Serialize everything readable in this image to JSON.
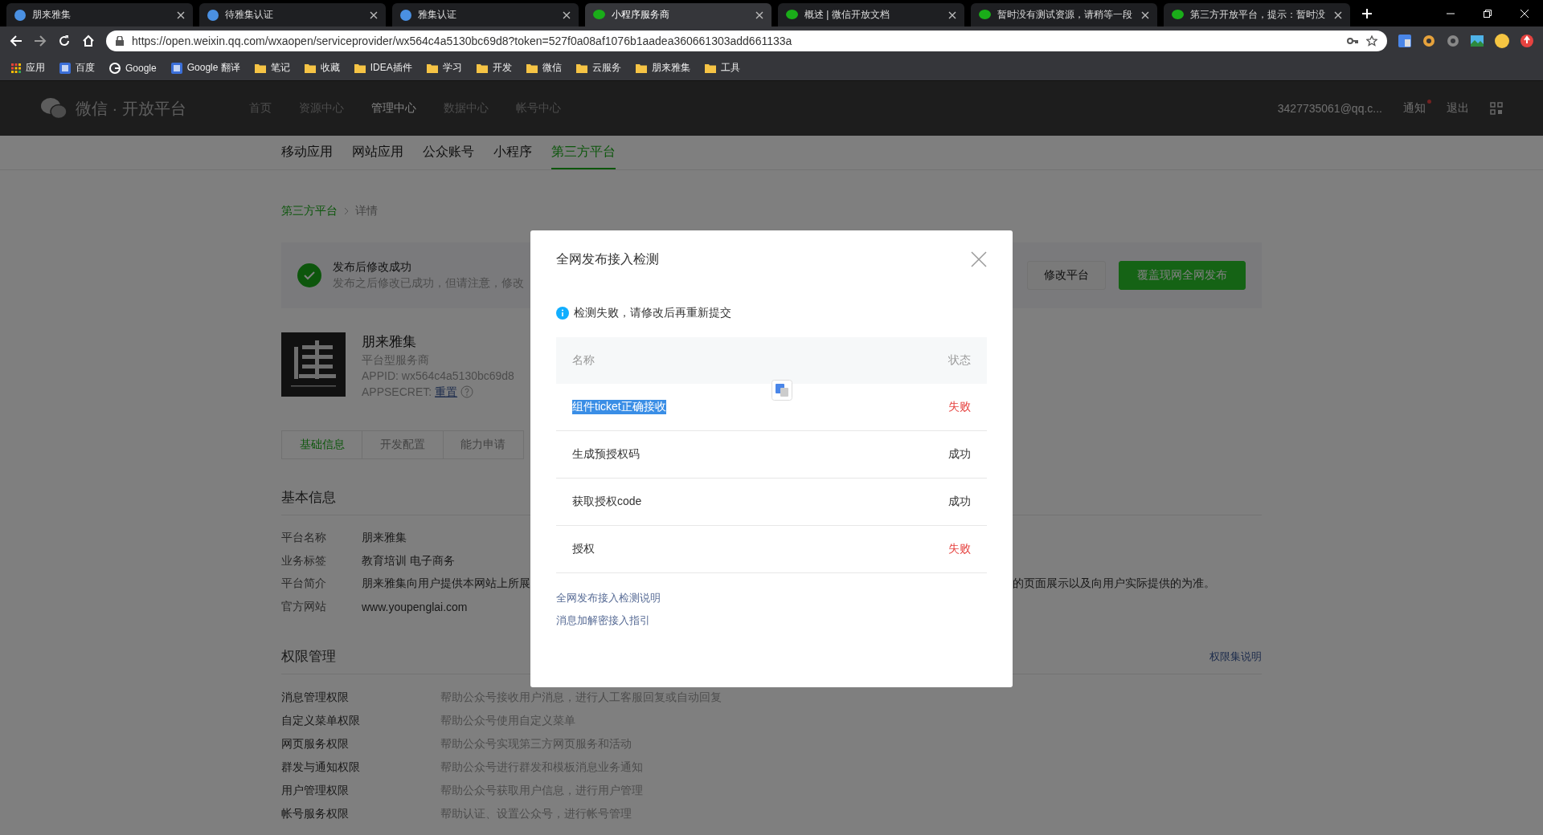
{
  "browser": {
    "tabs": [
      {
        "title": "朋来雅集",
        "selected": false,
        "kind": "site"
      },
      {
        "title": "待雅集认证",
        "selected": false,
        "kind": "site"
      },
      {
        "title": "雅集认证",
        "selected": false,
        "kind": "site"
      },
      {
        "title": "小程序服务商",
        "selected": true,
        "kind": "wechat"
      },
      {
        "title": "概述 | 微信开放文档",
        "selected": false,
        "kind": "wechat"
      },
      {
        "title": "暂时没有测试资源，请稍等一段",
        "selected": false,
        "kind": "wechat"
      },
      {
        "title": "第三方开放平台，提示：暂时没",
        "selected": false,
        "kind": "wechat"
      }
    ],
    "url": "https://open.weixin.qq.com/wxaopen/serviceprovider/wx564c4a5130bc69d8?token=527f0a08af1076b1aadea360661303add661133a",
    "bookmarks": [
      {
        "label": "应用",
        "kind": "apps"
      },
      {
        "label": "百度",
        "kind": "site"
      },
      {
        "label": "Google",
        "kind": "google"
      },
      {
        "label": "Google 翻译",
        "kind": "site"
      },
      {
        "label": "笔记",
        "kind": "folder"
      },
      {
        "label": "收藏",
        "kind": "folder"
      },
      {
        "label": "IDEA插件",
        "kind": "folder"
      },
      {
        "label": "学习",
        "kind": "folder"
      },
      {
        "label": "开发",
        "kind": "folder"
      },
      {
        "label": "微信",
        "kind": "folder"
      },
      {
        "label": "云服务",
        "kind": "folder"
      },
      {
        "label": "朋来雅集",
        "kind": "folder"
      },
      {
        "label": "工具",
        "kind": "folder"
      }
    ]
  },
  "header": {
    "logo_text": "微信 · 开放平台",
    "nav": [
      {
        "label": "首页",
        "selected": false
      },
      {
        "label": "资源中心",
        "selected": false
      },
      {
        "label": "管理中心",
        "selected": true
      },
      {
        "label": "数据中心",
        "selected": false
      },
      {
        "label": "帐号中心",
        "selected": false
      }
    ],
    "account": "3427735061@qq.c...",
    "notify": {
      "label": "通知",
      "unread": true
    },
    "logout": "退出"
  },
  "subnav": [
    {
      "label": "移动应用",
      "selected": false
    },
    {
      "label": "网站应用",
      "selected": false
    },
    {
      "label": "公众账号",
      "selected": false
    },
    {
      "label": "小程序",
      "selected": false
    },
    {
      "label": "第三方平台",
      "selected": true
    }
  ],
  "breadcrumb": [
    "第三方平台",
    "详情"
  ],
  "banner": {
    "title": "发布后修改成功",
    "message": "发布之后修改已成功，但请注意，修改",
    "buttons": [
      {
        "label": "修改平台",
        "kind": "default"
      },
      {
        "label": "覆盖现网全网发布",
        "kind": "primary"
      }
    ]
  },
  "profile": {
    "name": "朋来雅集",
    "type": "平台型服务商",
    "appid": "APPID: wx564c4a5130bc69d8",
    "appsecret_label": "APPSECRET:",
    "appsecret_action": "重置"
  },
  "detail_tabs": [
    {
      "label": "基础信息",
      "selected": true
    },
    {
      "label": "开发配置",
      "selected": false
    },
    {
      "label": "能力申请",
      "selected": false
    }
  ],
  "basic_info": {
    "title": "基本信息",
    "fields": [
      {
        "label": "平台名称",
        "values": [
          "朋来雅集"
        ]
      },
      {
        "label": "业务标签",
        "values": [
          "教育培训 电子商务"
        ]
      },
      {
        "label": "平台简介",
        "values": [
          "朋来雅集向用户提供本网站上所展",
          "的页面展示以及向用户实际提供的为准。"
        ]
      },
      {
        "label": "官方网站",
        "values": [
          "www.youpenglai.com"
        ]
      }
    ]
  },
  "permissions": {
    "title": "权限管理",
    "help_link": "权限集说明",
    "rows": [
      {
        "name": "消息管理权限",
        "description": "帮助公众号接收用户消息，进行人工客服回复或自动回复"
      },
      {
        "name": "自定义菜单权限",
        "description": "帮助公众号使用自定义菜单"
      },
      {
        "name": "网页服务权限",
        "description": "帮助公众号实现第三方网页服务和活动"
      },
      {
        "name": "群发与通知权限",
        "description": "帮助公众号进行群发和模板消息业务通知"
      },
      {
        "name": "用户管理权限",
        "description": "帮助公众号获取用户信息，进行用户管理"
      },
      {
        "name": "帐号服务权限",
        "description": "帮助认证、设置公众号，进行帐号管理"
      }
    ]
  },
  "modal": {
    "title": "全网发布接入检测",
    "notice": "检测失败，请修改后再重新提交",
    "columns": [
      "名称",
      "状态"
    ],
    "rows": [
      {
        "name": "组件ticket正确接收",
        "status": "失败",
        "ok": false,
        "selected": true
      },
      {
        "name": "生成预授权码",
        "status": "成功",
        "ok": true,
        "selected": false
      },
      {
        "name": "获取授权code",
        "status": "成功",
        "ok": true,
        "selected": false
      },
      {
        "name": "授权",
        "status": "失败",
        "ok": false,
        "selected": false
      }
    ],
    "links": [
      "全网发布接入检测说明",
      "消息加解密接入指引"
    ]
  }
}
